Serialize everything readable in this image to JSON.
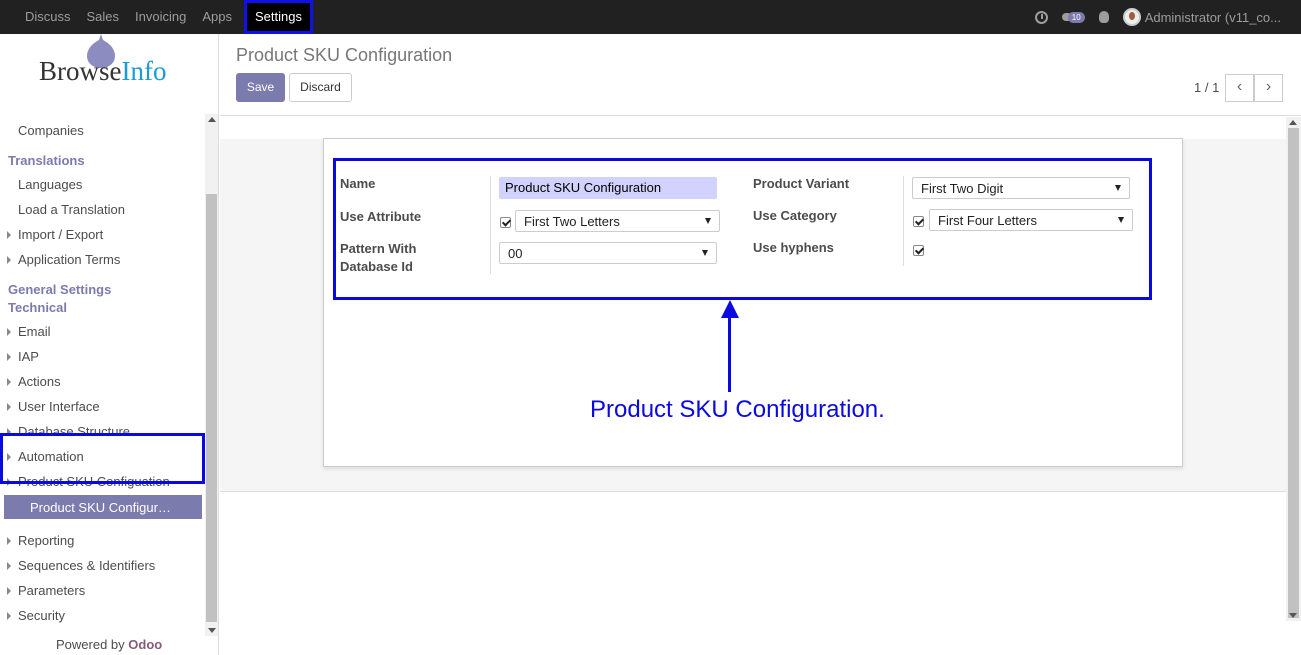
{
  "navbar": {
    "menu": [
      "Discuss",
      "Sales",
      "Invoicing",
      "Apps",
      "Settings"
    ],
    "active": "Settings",
    "chat_count": "10",
    "user": "Administrator (v11_co..."
  },
  "sidebar": {
    "logo_text_a": "Browse",
    "logo_text_b": "Info",
    "items": {
      "companies": "Companies",
      "translations": "Translations",
      "languages": "Languages",
      "load_translation": "Load a Translation",
      "import_export": "Import / Export",
      "application_terms": "Application Terms",
      "general_settings": "General Settings",
      "technical": "Technical",
      "email": "Email",
      "iap": "IAP",
      "actions": "Actions",
      "user_interface": "User Interface",
      "database_structure": "Database Structure",
      "automation": "Automation",
      "product_sku_configuation": "Product SKU Configuation",
      "product_sku_config_sub": "Product SKU Configur…",
      "reporting": "Reporting",
      "sequences": "Sequences & Identifiers",
      "parameters": "Parameters",
      "security": "Security"
    },
    "powered_by": "Powered by",
    "odoo": "Odoo"
  },
  "control": {
    "title": "Product SKU Configuration",
    "save": "Save",
    "discard": "Discard",
    "pager": "1 / 1",
    "prev": "‹",
    "next": "›"
  },
  "form": {
    "name_label": "Name",
    "name_value": "Product SKU Configuration",
    "use_attribute_label": "Use Attribute",
    "use_attribute_checked": true,
    "use_attribute_value": "First Two Letters",
    "pattern_label_1": "Pattern With",
    "pattern_label_2": "Database Id",
    "pattern_value": "00",
    "product_variant_label": "Product Variant",
    "product_variant_value": "First Two Digit",
    "use_category_label": "Use Category",
    "use_category_checked": true,
    "use_category_value": "First Four Letters",
    "use_hyphens_label": "Use hyphens",
    "use_hyphens_checked": true
  },
  "annotation": "Product SKU Configuration."
}
